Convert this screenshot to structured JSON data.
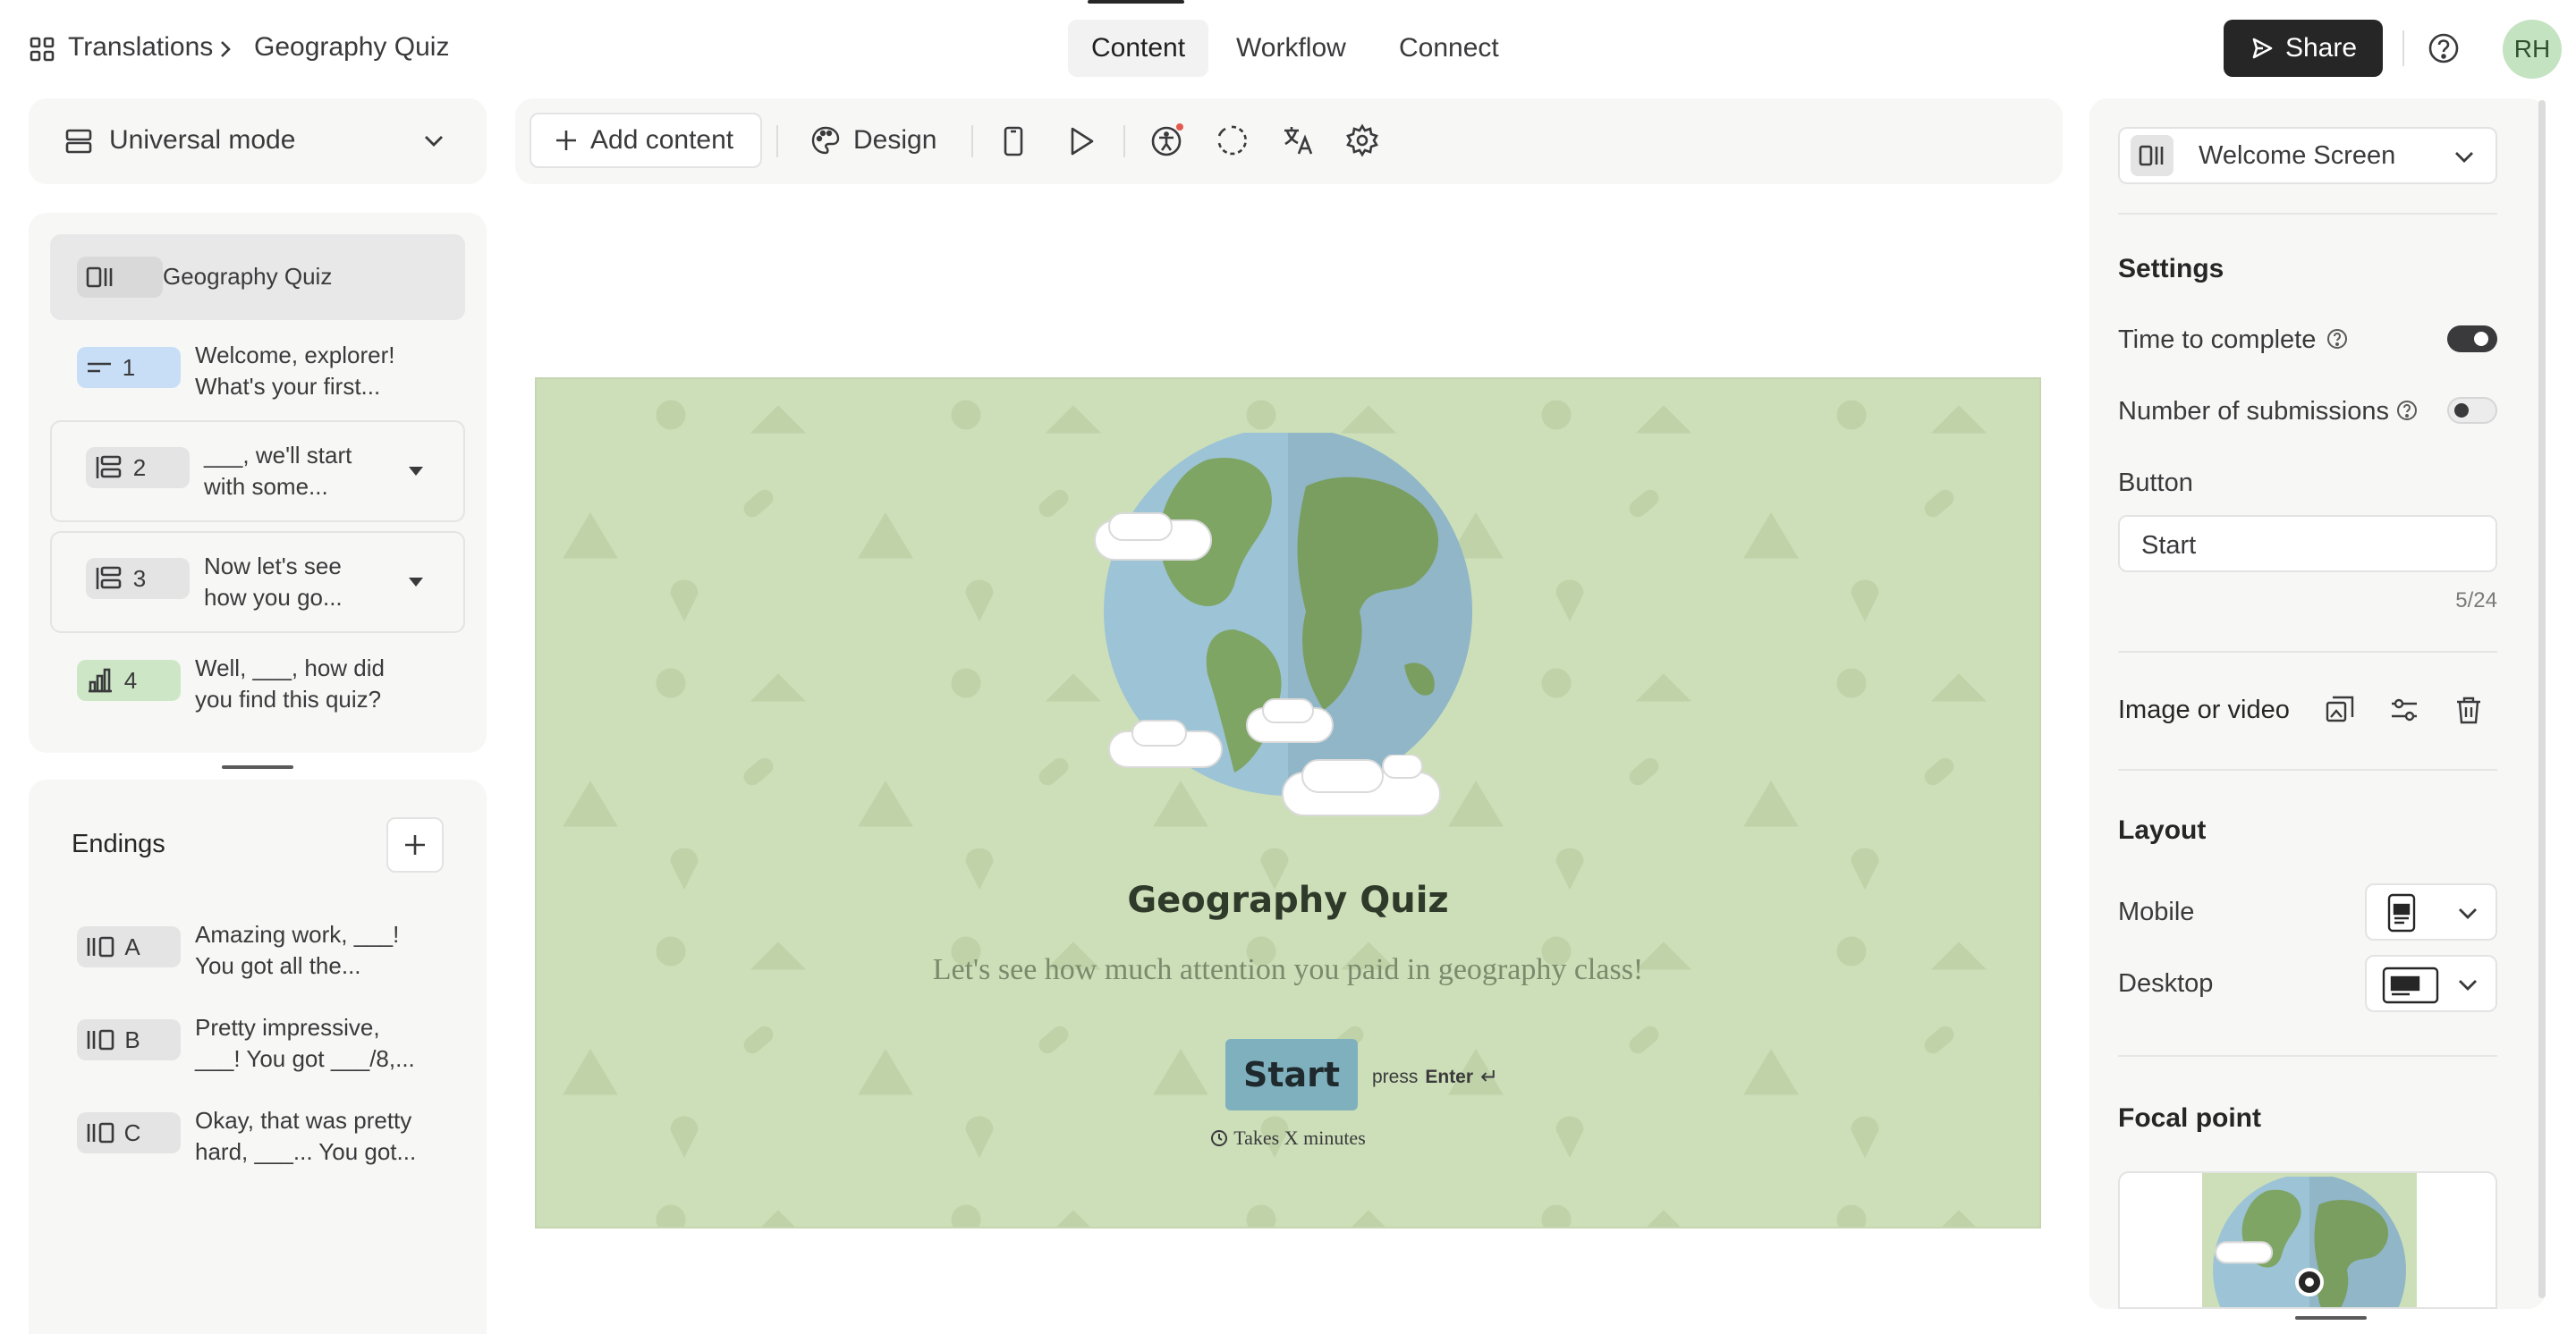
{
  "breadcrumb": {
    "root": "Translations",
    "current": "Geography Quiz"
  },
  "tabs": [
    {
      "label": "Content"
    },
    {
      "label": "Workflow"
    },
    {
      "label": "Connect"
    }
  ],
  "share_label": "Share",
  "avatar_initials": "RH",
  "mode_select": "Universal mode",
  "toolbar": {
    "add_content": "Add content",
    "design": "Design"
  },
  "sidebar": {
    "title_item": "Geography Quiz",
    "questions": [
      {
        "num": "1",
        "line1": "Welcome, explorer!",
        "line2": "What's your first..."
      },
      {
        "num": "2",
        "line1": "___, we'll start",
        "line2": "with some..."
      },
      {
        "num": "3",
        "line1": "Now let's see",
        "line2": "how you go..."
      },
      {
        "num": "4",
        "line1": "Well, ___, how did",
        "line2": "you find this quiz?"
      }
    ],
    "endings_title": "Endings",
    "endings": [
      {
        "letter": "A",
        "line1": "Amazing work, ___!",
        "line2": "You got all the..."
      },
      {
        "letter": "B",
        "line1": "Pretty impressive,",
        "line2": "___! You got ___/8,..."
      },
      {
        "letter": "C",
        "line1": "Okay, that was pretty",
        "line2": "hard, ___... You got..."
      }
    ]
  },
  "preview": {
    "title": "Geography Quiz",
    "subtitle": "Let's see how much attention you paid in geography class!",
    "button": "Start",
    "press": "press",
    "enter": "Enter",
    "enter_symbol": "↵",
    "duration": "Takes X minutes"
  },
  "right": {
    "screen_select": "Welcome Screen",
    "settings": "Settings",
    "time_to_complete": "Time to complete",
    "time_to_complete_on": true,
    "num_submissions": "Number of submissions",
    "num_submissions_on": false,
    "button_label": "Button",
    "button_value": "Start",
    "char_count": "5/24",
    "image_or_video": "Image or video",
    "layout": "Layout",
    "mobile": "Mobile",
    "desktop": "Desktop",
    "focal_point": "Focal point"
  },
  "colors": {
    "canvas_bg": "#cddfb8",
    "start_button": "#7fb0bd",
    "badge_blue": "#c8def6",
    "badge_green": "#cde7c6",
    "badge_gray": "#e4e4e4",
    "dark": "#262627"
  }
}
